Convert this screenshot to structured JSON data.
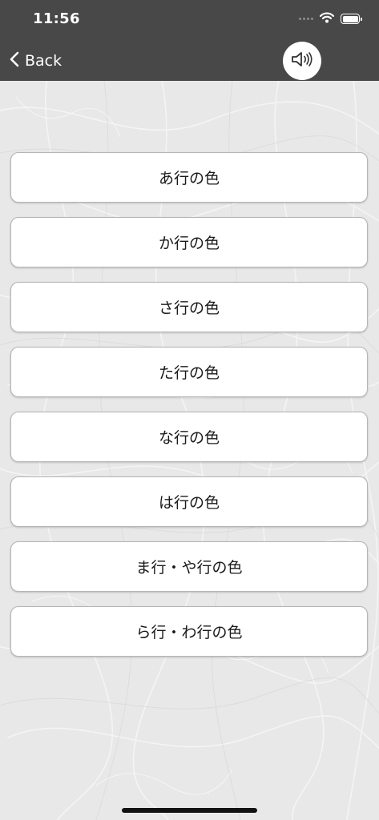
{
  "status_bar": {
    "time": "11:56",
    "icons": [
      "cellular-signal-icon",
      "wifi-icon",
      "battery-icon"
    ]
  },
  "nav": {
    "back_label": "Back",
    "back_icon": "chevron-left-icon",
    "sound_icon": "speaker-icon"
  },
  "menu": {
    "items": [
      {
        "label": "あ行の色"
      },
      {
        "label": "か行の色"
      },
      {
        "label": "さ行の色"
      },
      {
        "label": "た行の色"
      },
      {
        "label": "な行の色"
      },
      {
        "label": "は行の色"
      },
      {
        "label": "ま行・や行の色"
      },
      {
        "label": "ら行・わ行の色"
      }
    ]
  },
  "colors": {
    "nav_background": "#484848",
    "page_background": "#e8e8e8",
    "button_background": "#ffffff",
    "button_border": "#b5b5b5"
  }
}
